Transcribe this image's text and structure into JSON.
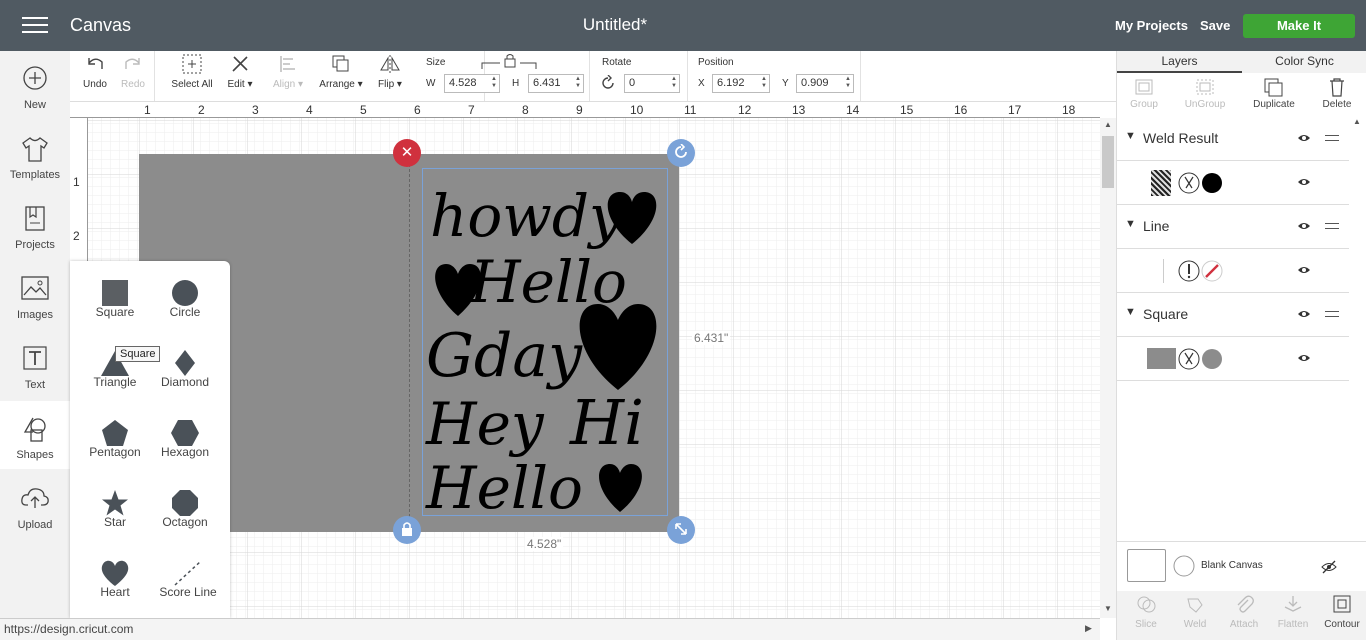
{
  "header": {
    "app_title": "Canvas",
    "doc_title": "Untitled*",
    "my_projects": "My Projects",
    "save": "Save",
    "make_it": "Make It"
  },
  "toolbar": {
    "undo": "Undo",
    "redo": "Redo",
    "select_all": "Select All",
    "edit": "Edit",
    "align": "Align",
    "arrange": "Arrange",
    "flip": "Flip",
    "size_label": "Size",
    "w_label": "W",
    "w_value": "4.528",
    "h_label": "H",
    "h_value": "6.431",
    "rotate_label": "Rotate",
    "rotate_value": "0",
    "position_label": "Position",
    "x_label": "X",
    "x_value": "6.192",
    "y_label": "Y",
    "y_value": "0.909"
  },
  "sidebar": {
    "items": [
      {
        "label": "New",
        "icon": "plus-circle-icon"
      },
      {
        "label": "Templates",
        "icon": "shirt-icon"
      },
      {
        "label": "Projects",
        "icon": "book-icon"
      },
      {
        "label": "Images",
        "icon": "image-icon"
      },
      {
        "label": "Text",
        "icon": "text-icon"
      },
      {
        "label": "Shapes",
        "icon": "shapes-icon"
      },
      {
        "label": "Upload",
        "icon": "cloud-upload-icon"
      }
    ]
  },
  "ruler": {
    "top": [
      "1",
      "2",
      "3",
      "4",
      "5",
      "6",
      "7",
      "8",
      "9",
      "10",
      "11",
      "12",
      "13",
      "14",
      "15",
      "16",
      "17",
      "18"
    ],
    "left": [
      "1",
      "2"
    ]
  },
  "selection": {
    "height_dim": "6.431\"",
    "width_dim": "4.528\""
  },
  "design_text": [
    "howdy",
    "Hello",
    "Gday",
    "Hey",
    "Hi",
    "Hello"
  ],
  "shapes": {
    "items": [
      "Square",
      "Circle",
      "Triangle",
      "Diamond",
      "Pentagon",
      "Hexagon",
      "Star",
      "Octagon",
      "Heart",
      "Score Line"
    ],
    "tooltip": "Square"
  },
  "panel": {
    "tabs": [
      "Layers",
      "Color Sync"
    ],
    "tools": [
      "Group",
      "UnGroup",
      "Duplicate",
      "Delete"
    ],
    "layers": [
      {
        "name": "Weld Result"
      },
      {
        "name": "Line"
      },
      {
        "name": "Square"
      }
    ],
    "blank_canvas": "Blank Canvas",
    "bottom_tools": [
      "Slice",
      "Weld",
      "Attach",
      "Flatten",
      "Contour"
    ]
  },
  "colors": {
    "topbar": "#505a62",
    "make_it": "#3ea535",
    "square_fill": "#8c8c8c",
    "selection": "#7aa2d8",
    "close_btn": "#d0313e"
  },
  "status": {
    "url": "https://design.cricut.com"
  }
}
